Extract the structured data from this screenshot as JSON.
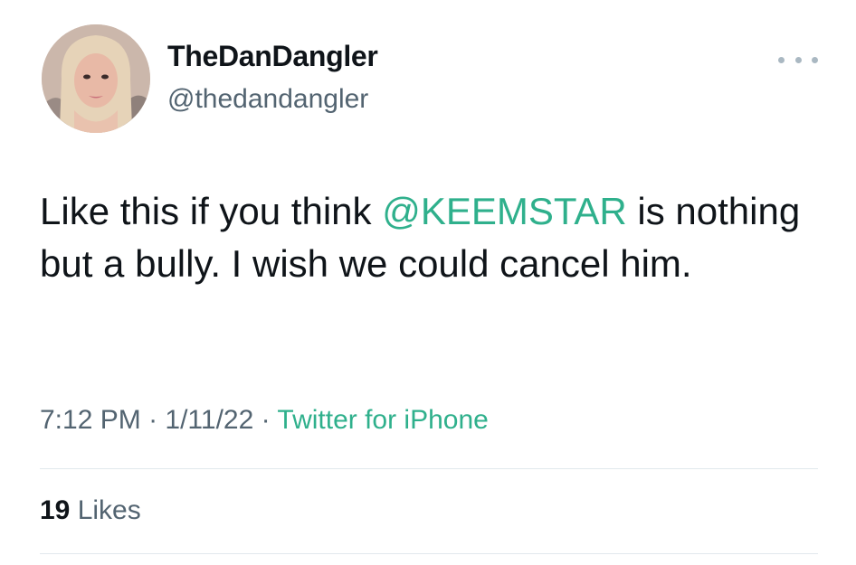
{
  "user": {
    "display_name": "TheDanDangler",
    "handle": "@thedandangler"
  },
  "tweet": {
    "text_before_mention": "Like this if you think ",
    "mention": "@KEEMSTAR",
    "text_after_mention": " is nothing but a bully. I wish we could cancel him."
  },
  "meta": {
    "time": "7:12 PM",
    "separator1": " · ",
    "date": "1/11/22",
    "separator2": " · ",
    "source": "Twitter for iPhone"
  },
  "stats": {
    "likes_count": "19",
    "likes_label": " Likes"
  },
  "colors": {
    "link": "#2fb08c",
    "secondary_text": "#536471",
    "divider": "#e1e8ed"
  },
  "icons": {
    "more": "more-horizontal-icon"
  }
}
